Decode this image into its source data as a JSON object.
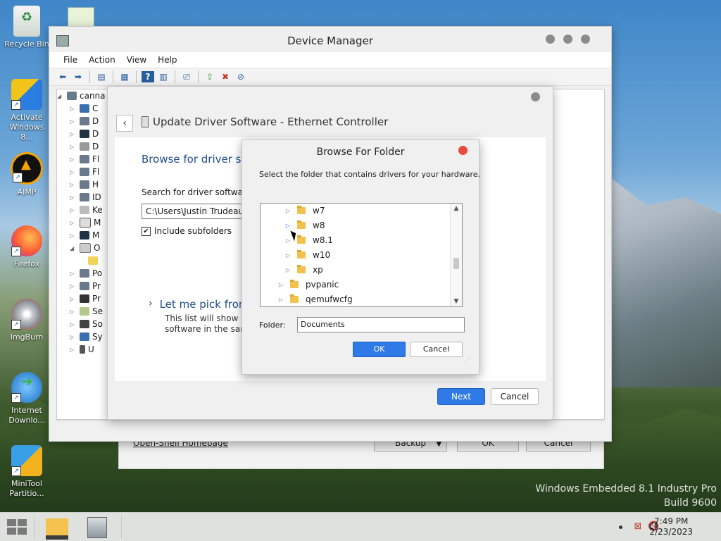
{
  "desktop": {
    "icons": [
      {
        "label": "Recycle Bin",
        "icon": "recycle-bin-icon"
      },
      {
        "label": "Activate Windows 8...",
        "icon": "key-shield-icon"
      },
      {
        "label": "AIMP",
        "icon": "aimp-icon"
      },
      {
        "label": "Firefox",
        "icon": "firefox-icon"
      },
      {
        "label": "ImgBurn",
        "icon": "imgburn-icon"
      },
      {
        "label": "Internet Downlo...",
        "icon": "download-globe-icon"
      },
      {
        "label": "MiniTool Partitio...",
        "icon": "minitool-icon"
      }
    ],
    "watermark_line1": "Windows Embedded 8.1 Industry Pro",
    "watermark_line2": "Build 9600"
  },
  "device_manager": {
    "title": "Device Manager",
    "menu": [
      "File",
      "Action",
      "View",
      "Help"
    ],
    "tree_root": "canna",
    "tree_items": [
      "C",
      "D",
      "D",
      "D",
      "Fl",
      "Fl",
      "H",
      "ID",
      "Ke",
      "M",
      "M",
      "O",
      "",
      "Po",
      "Pr",
      "Pr",
      "Se",
      "So",
      "Sy",
      "U"
    ]
  },
  "open_shell": {
    "link": "Open-Shell Homepage",
    "backup_label": "Backup",
    "ok_label": "OK",
    "cancel_label": "Cancel"
  },
  "update_driver": {
    "title": "Update Driver Software - Ethernet Controller",
    "heading": "Browse for driver sof",
    "search_label": "Search for driver software in",
    "path_value": "C:\\Users\\Justin Trudeau\\D",
    "include_subfolders": "Include subfolders",
    "let_me_pick": "Let me pick from",
    "desc_line1": "This list will show ins",
    "desc_line2": "software in the same",
    "next_label": "Next",
    "cancel_label": "Cancel"
  },
  "browse_folder": {
    "title": "Browse For Folder",
    "instruction": "Select the folder that contains drivers for your hardware.",
    "tree": [
      {
        "label": "w7",
        "indent": 2
      },
      {
        "label": "w8",
        "indent": 2,
        "highlight": true
      },
      {
        "label": "w8.1",
        "indent": 2
      },
      {
        "label": "w10",
        "indent": 2
      },
      {
        "label": "xp",
        "indent": 2
      },
      {
        "label": "pvpanic",
        "indent": 1
      },
      {
        "label": "qemufwcfg",
        "indent": 1
      }
    ],
    "folder_label": "Folder:",
    "folder_value": "Documents",
    "ok_label": "OK",
    "cancel_label": "Cancel"
  },
  "taskbar": {
    "time": "7:49 PM",
    "date": "2/23/2023"
  }
}
